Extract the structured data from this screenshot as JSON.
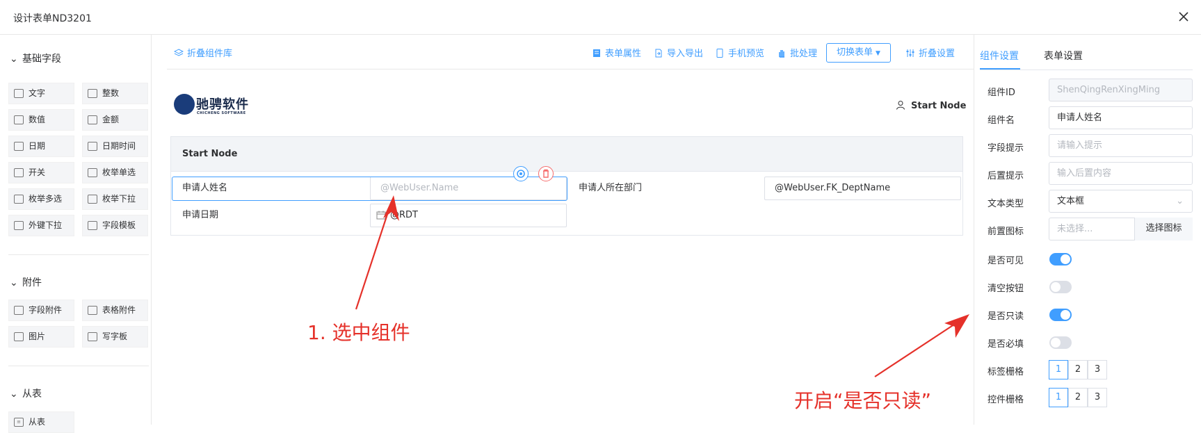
{
  "window": {
    "title": "设计表单ND3201"
  },
  "palette": {
    "groups": [
      {
        "label": "基础字段"
      },
      {
        "label": "附件"
      },
      {
        "label": "从表"
      }
    ],
    "basic": [
      "文字",
      "整数",
      "数值",
      "金额",
      "日期",
      "日期时间",
      "开关",
      "枚举单选",
      "枚举多选",
      "枚举下拉",
      "外键下拉",
      "字段模板"
    ],
    "basic_icons": [
      "text-icon",
      "integer-icon",
      "number-icon",
      "money-icon",
      "date-icon",
      "datetime-icon",
      "switch-icon",
      "radio-icon",
      "checkbox-icon",
      "dropdown-icon",
      "foreign-key-icon",
      "template-icon"
    ],
    "attach": [
      "字段附件",
      "表格附件",
      "图片",
      "写字板"
    ],
    "attach_icons": [
      "attachment-icon",
      "excel-icon",
      "image-icon",
      "pen-icon"
    ],
    "detail": [
      "从表"
    ]
  },
  "toolbar": {
    "collapse_lib": "折叠组件库",
    "form_props": "表单属性",
    "import_export": "导入导出",
    "mobile_preview": "手机预览",
    "batch": "批处理",
    "switch_form": "切换表单",
    "collapse_settings": "折叠设置"
  },
  "canvas": {
    "logo_text": "驰骋软件",
    "logo_sub": "CHICHENG SOFTWARE",
    "node_name": "Start Node",
    "section_title": "Start Node",
    "fields": [
      {
        "label": "申请人姓名",
        "value": "@WebUser.Name"
      },
      {
        "label": "申请人所在部门",
        "value": "@WebUser.FK_DeptName"
      },
      {
        "label": "申请日期",
        "value": "@RDT"
      }
    ],
    "annotation_1": "1. 选中组件",
    "annotation_2": "开启“是否只读”"
  },
  "panel": {
    "tabs": [
      "组件设置",
      "表单设置"
    ],
    "active_tab": "组件设置",
    "component_id_label": "组件ID",
    "component_id": "ShenQingRenXingMing",
    "component_name_label": "组件名",
    "component_name": "申请人姓名",
    "hint_label": "字段提示",
    "hint_placeholder": "请输入提示",
    "suffix_label": "后置提示",
    "suffix_placeholder": "输入后置内容",
    "text_type_label": "文本类型",
    "text_type": "文本框",
    "prefix_icon_label": "前置图标",
    "prefix_icon_placeholder": "未选择...",
    "prefix_icon_button": "选择图标",
    "visible_label": "是否可见",
    "visible": true,
    "clear_label": "清空按钮",
    "clear": false,
    "readonly_label": "是否只读",
    "readonly": true,
    "required_label": "是否必填",
    "required": false,
    "label_grid_label": "标签栅格",
    "control_grid_label": "控件栅格",
    "grid_options": [
      "1",
      "2",
      "3"
    ],
    "label_grid_selected": "1",
    "control_grid_selected": "1"
  },
  "colors": {
    "accent": "#409eff",
    "danger": "#f56c6c",
    "annotation": "#e5312a"
  }
}
